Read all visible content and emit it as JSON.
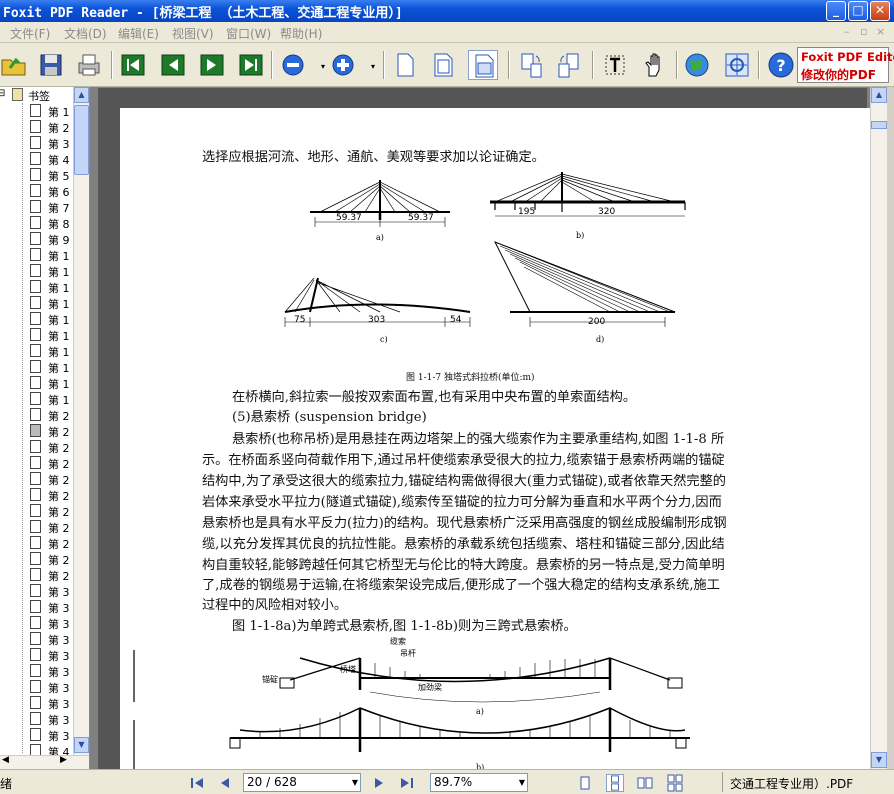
{
  "window": {
    "title": "Foxit PDF Reader - [桥梁工程  （土木工程、交通工程专业用）]"
  },
  "menu": {
    "items": [
      "文件(F)",
      "文档(D)",
      "编辑(E)",
      "视图(V)",
      "窗口(W)",
      "帮助(H)"
    ]
  },
  "toolbar": {
    "ad_line1": "Foxit PDF Editor",
    "ad_line2": "修改你的PDF",
    "colors": {
      "ad_text": "#d10000",
      "title_bar": "#0a53d8"
    }
  },
  "bookmarks": {
    "root_label": "书签",
    "items": [
      "第 1",
      "第 2",
      "第 3",
      "第 4",
      "第 5",
      "第 6",
      "第 7",
      "第 8",
      "第 9",
      "第 1",
      "第 1",
      "第 1",
      "第 1",
      "第 1",
      "第 1",
      "第 1",
      "第 1",
      "第 1",
      "第 1",
      "第 2",
      "第 2",
      "第 2",
      "第 2",
      "第 2",
      "第 2",
      "第 2",
      "第 2",
      "第 2",
      "第 2",
      "第 2",
      "第 3",
      "第 3",
      "第 3",
      "第 3",
      "第 3",
      "第 3",
      "第 3",
      "第 3",
      "第 3",
      "第 3",
      "第 4",
      "第 4"
    ],
    "selected_index": 20
  },
  "page": {
    "line_top": "选择应根据河流、地形、通航、美观等要求加以论证确定。",
    "figure1": {
      "caption": "图 1-1-7   独塔式斜拉桥(单位:m)",
      "a": {
        "label": "a)",
        "spans": [
          "59.37",
          "59.37"
        ]
      },
      "b": {
        "label": "b)",
        "spans": [
          "195",
          "320"
        ]
      },
      "c": {
        "label": "c)",
        "spans": [
          "75",
          "303",
          "54"
        ]
      },
      "d": {
        "label": "d)",
        "spans": [
          "200"
        ]
      }
    },
    "paragraphs": [
      "在桥横向,斜拉索一般按双索面布置,也有采用中央布置的单索面结构。",
      "(5)悬索桥 (suspension bridge)",
      "悬索桥(也称吊桥)是用悬挂在两边塔架上的强大缆索作为主要承重结构,如图 1-1-8 所",
      "示。在桥面系竖向荷载作用下,通过吊杆使缆索承受很大的拉力,缆索锚于悬索桥两端的锚碇",
      "结构中,为了承受这很大的缆索拉力,锚碇结构需做得很大(重力式锚碇),或者依靠天然完整的",
      "岩体来承受水平拉力(隧道式锚碇),缆索传至锚碇的拉力可分解为垂直和水平两个分力,因而",
      "悬索桥也是具有水平反力(拉力)的结构。现代悬索桥广泛采用高强度的钢丝成股编制形成钢",
      "缆,以充分发挥其优良的抗拉性能。悬索桥的承载系统包括缆索、塔柱和锚碇三部分,因此结",
      "构自重较轻,能够跨越任何其它桥型无与伦比的特大跨度。悬索桥的另一特点是,受力简单明",
      "了,成卷的钢缆易于运输,在将缆索架设完成后,便形成了一个强大稳定的结构支承系统,施工",
      "过程中的风险相对较小。",
      "图 1-1-8a)为单跨式悬索桥,图 1-1-8b)则为三跨式悬索桥。"
    ],
    "figure2": {
      "labels": {
        "cable": "缆索",
        "hanger": "吊杆",
        "tower": "桥塔",
        "anchor": "锚碇",
        "girder": "加劲梁"
      },
      "a": "a)",
      "b": "b)"
    }
  },
  "status": {
    "left_text": "绪",
    "page_current": "20 / 628",
    "zoom": "89.7%",
    "right_text": "交通工程专业用）.PDF"
  }
}
